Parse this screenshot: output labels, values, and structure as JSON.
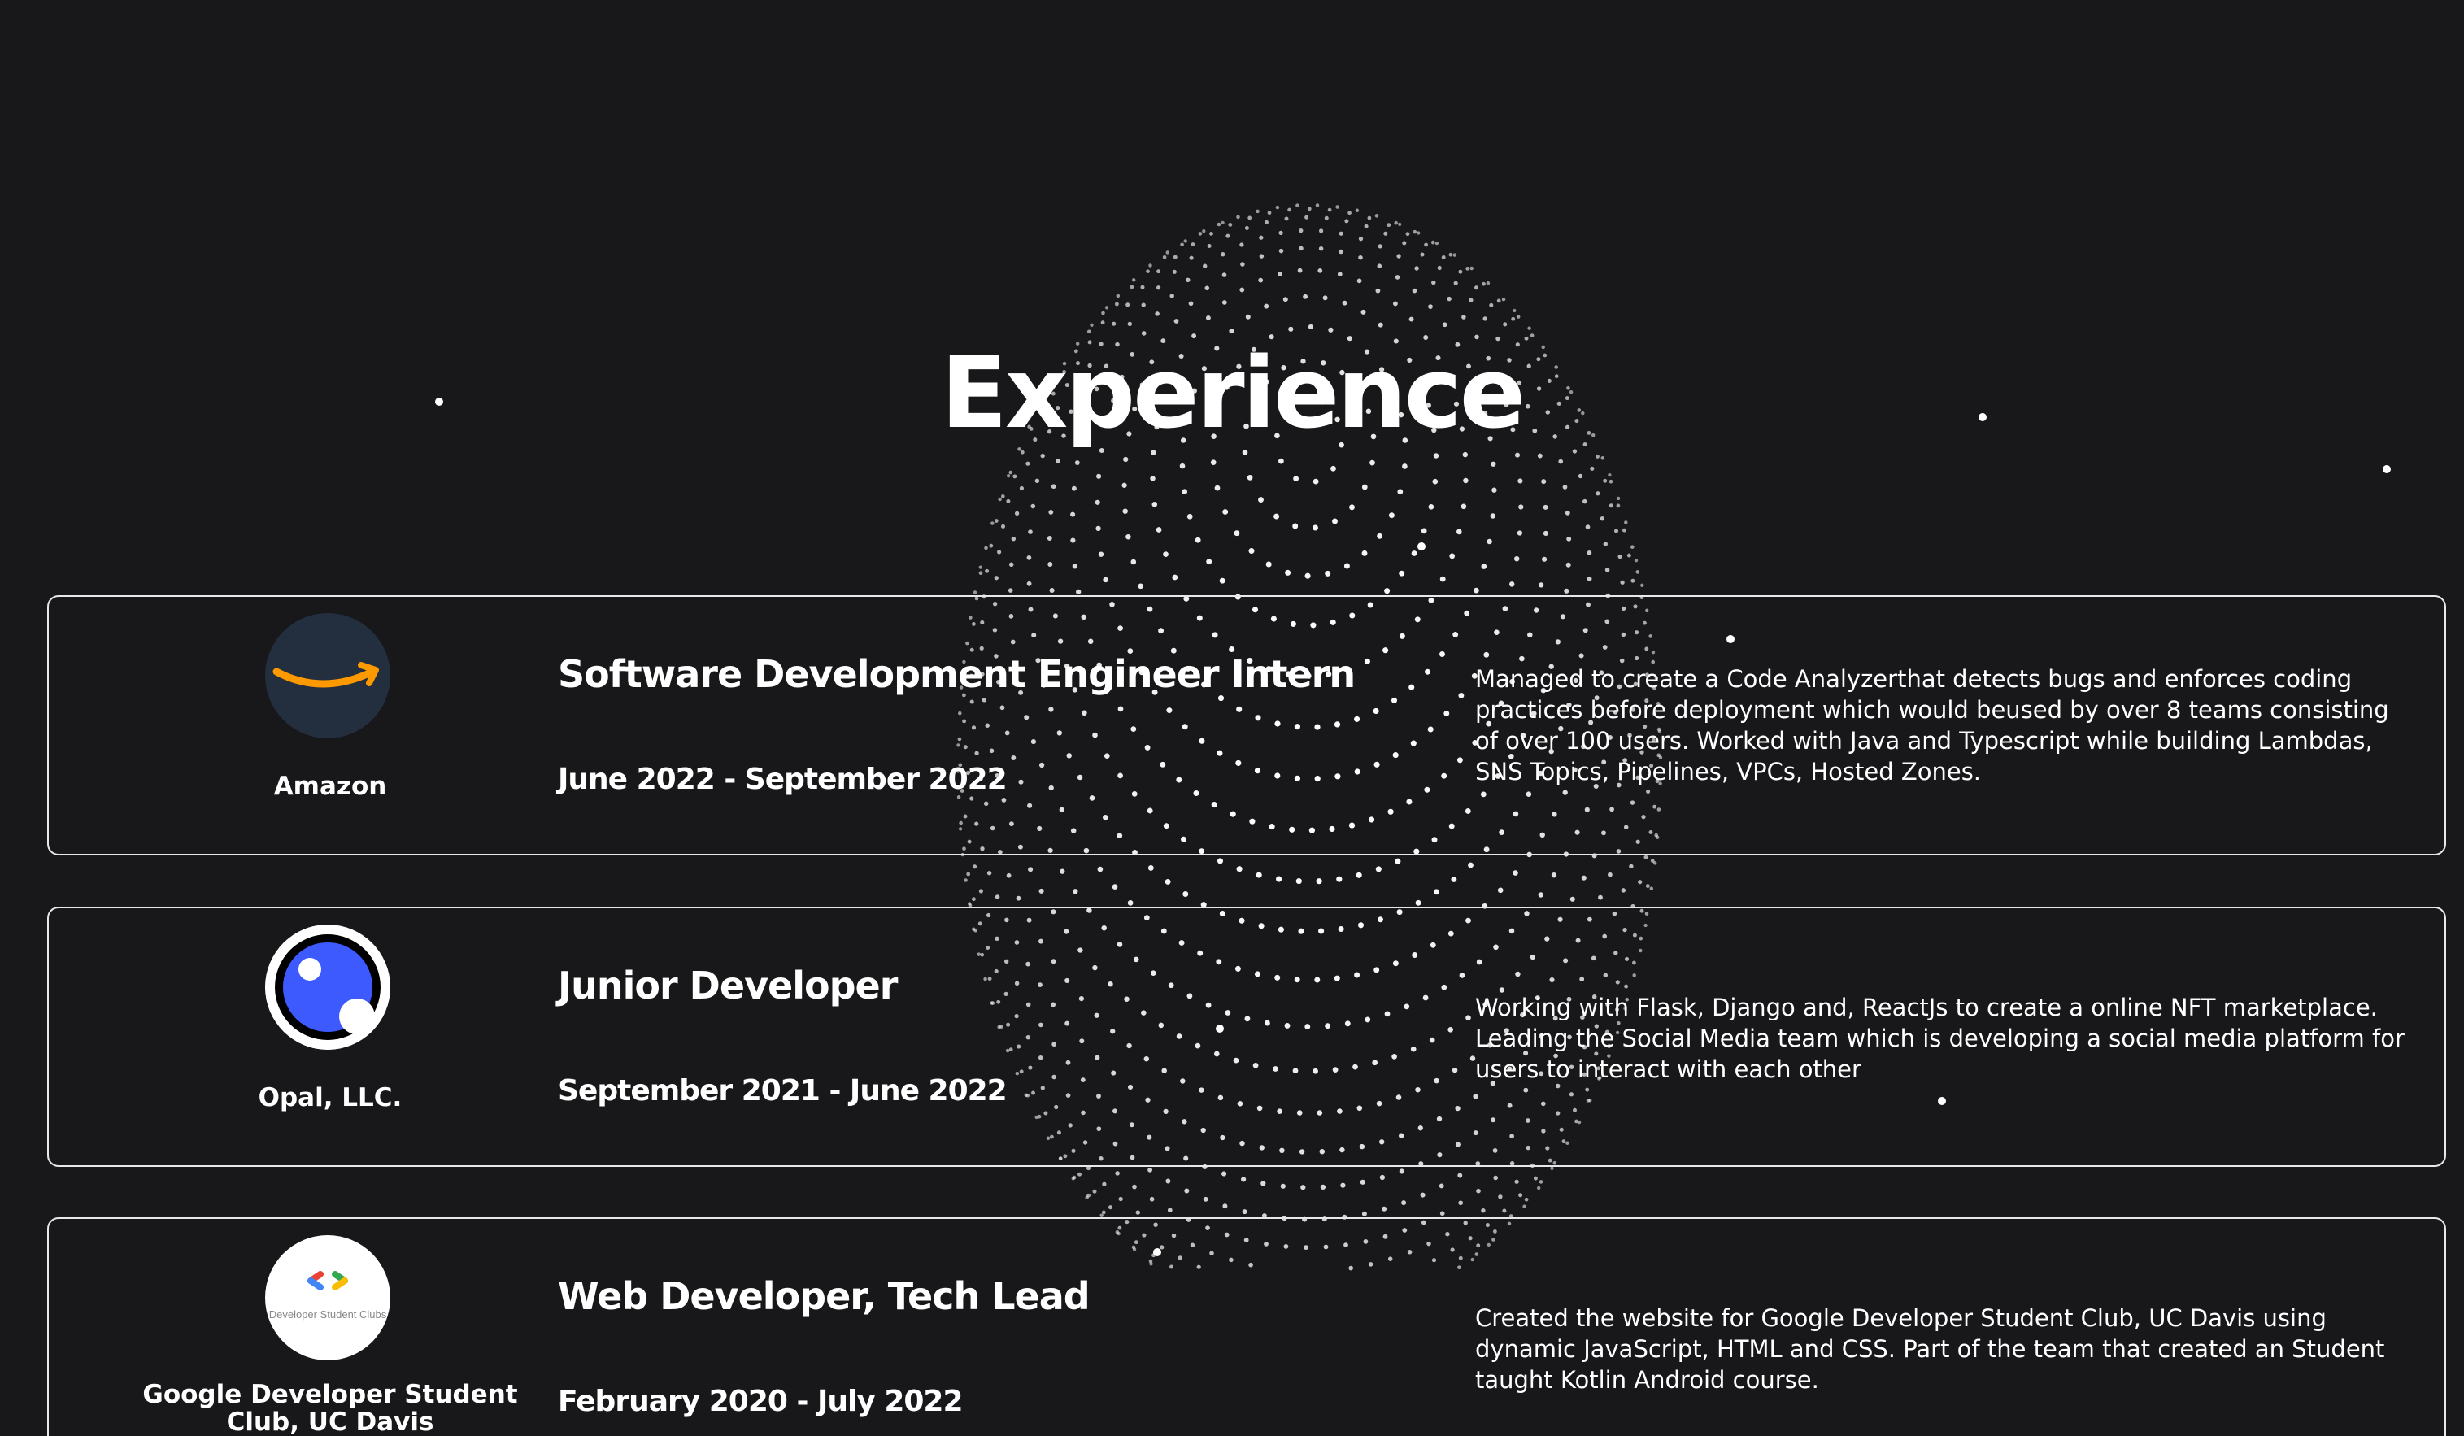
{
  "page": {
    "title": "Experience",
    "background_color": "#18181a",
    "text_color": "#ffffff"
  },
  "experience": [
    {
      "company": "Amazon",
      "logo": "amazon-smile-logo",
      "role": "Software Development Engineer Intern",
      "dates": "June 2022 - September 2022",
      "description": "Managed to create a Code Analyzerthat detects bugs and enforces coding practices before deployment which would beused by over 8 teams consisting of over 100 users. Worked with Java and Typescript while building Lambdas, SNS Topics, Pipelines, VPCs, Hosted Zones."
    },
    {
      "company": "Opal, LLC.",
      "logo": "opal-logo",
      "role": "Junior Developer",
      "dates": "September 2021 - June 2022",
      "description": "Working with Flask, Django and, ReactJs to create a online NFT marketplace. Leading the Social Media team which is developing a social media platform for users to interact with each other"
    },
    {
      "company": "Google Developer Student Club, UC Davis",
      "logo": "gdsc-logo",
      "logo_text": "Developer Student Clubs",
      "role": "Web Developer, Tech Lead",
      "dates": "February 2020 - July 2022",
      "description": "Created the website for Google Developer Student Club, UC Davis using dynamic JavaScript, HTML and CSS. Part of the team that created an Student taught Kotlin Android course."
    }
  ],
  "colors": {
    "amazon_bg": "#232f3e",
    "amazon_arrow": "#ff9900",
    "opal_blue": "#3d5afe",
    "gdsc_red": "#ea4335",
    "gdsc_blue": "#4285f4",
    "gdsc_green": "#34a853",
    "gdsc_yellow": "#fbbc04",
    "card_border": "#e8e8e8",
    "globe_dots": "#ffffff"
  }
}
